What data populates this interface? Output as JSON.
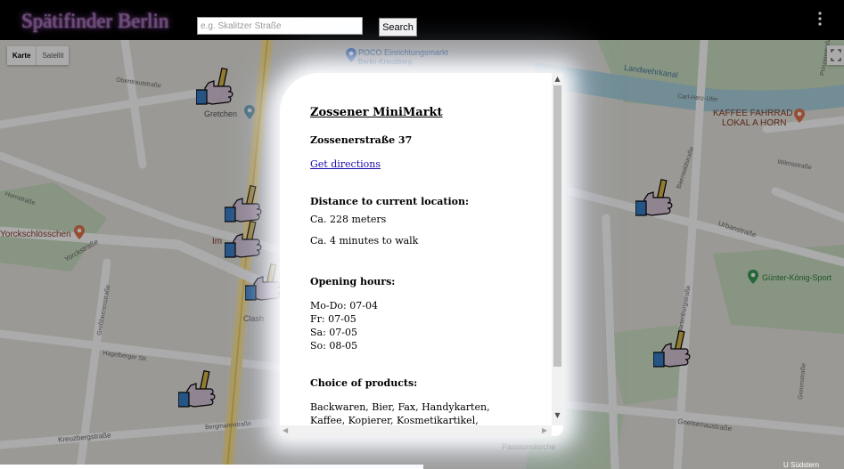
{
  "header": {
    "title": "Spätifinder Berlin",
    "search_placeholder": "e.g. Skalitzer Straße",
    "search_button": "Search",
    "menu_icon": "kebab-menu-icon"
  },
  "map": {
    "type_control": {
      "map_label": "Karte",
      "satellite_label": "Satellit"
    },
    "fullscreen_icon": "fullscreen-icon",
    "marker_icon": "thumbs-up-beer-icon",
    "poi_labels": {
      "gretchen": "Gretchen",
      "poco": "POCO Einrichtungsmarkt",
      "poco_sub": "Berlin-Kreuzberg",
      "kaffee_1": "KAFFEE FAHRRAD",
      "kaffee_2": "LOKAL A HORN",
      "guenter": "Günter-König-Sport",
      "yorckschloesschen": "Yorckschlösschen",
      "clash": "Clash",
      "passionskirche": "Passionskirche",
      "im": "Im",
      "u_suedstern": "U Südstern"
    },
    "street_labels": {
      "obentrautstrasse": "Obentrautstraße",
      "hornstrasse": "Hornstraße",
      "yorckstrasse": "Yorckstraße",
      "grossbeerenstrasse": "Großbeerenstraße",
      "hagelberger_str": "Hagelberger Str.",
      "kreuzbergstrasse": "Kreuzbergstraße",
      "bergmannstrasse": "Bergmannstraße",
      "urbanstrasse": "Urbanstraße",
      "baerwaldstrasse": "Baerwaldstraße",
      "landwehrkanal": "Landwehrkanal",
      "carl_herz_ufer": "Carl-Herz-Ufer",
      "gneisenaustrasse": "Gneisenaustraße",
      "wilmsstrasse": "Wilmsstraße",
      "grimmstrasse": "Grimmstraße",
      "prinzenstrasse": "Prinzenstraße",
      "wartenburgstrasse": "Wartenburgstraße",
      "kreuzbergstrasse_2": "Kreuzbergstraße"
    },
    "scale_label": "U Südstern"
  },
  "modal": {
    "shop_name": "Zossener MiniMarkt",
    "address": "Zossenerstraße 37",
    "directions_link": "Get directions",
    "distance_heading": "Distance to current location:",
    "distance_meters": "Ca. 228 meters",
    "distance_walk": "Ca. 4 minutes to walk",
    "hours_heading": "Opening hours:",
    "hours": [
      "Mo-Do: 07-04",
      "Fr: 07-05",
      "Sa: 07-05",
      "So: 08-05"
    ],
    "products_heading": "Choice of products:",
    "products_text": "Backwaren, Bier, Fax, Handykarten, Kaffee, Kopierer, Kosmetikartikel, Milchprodukte,"
  }
}
